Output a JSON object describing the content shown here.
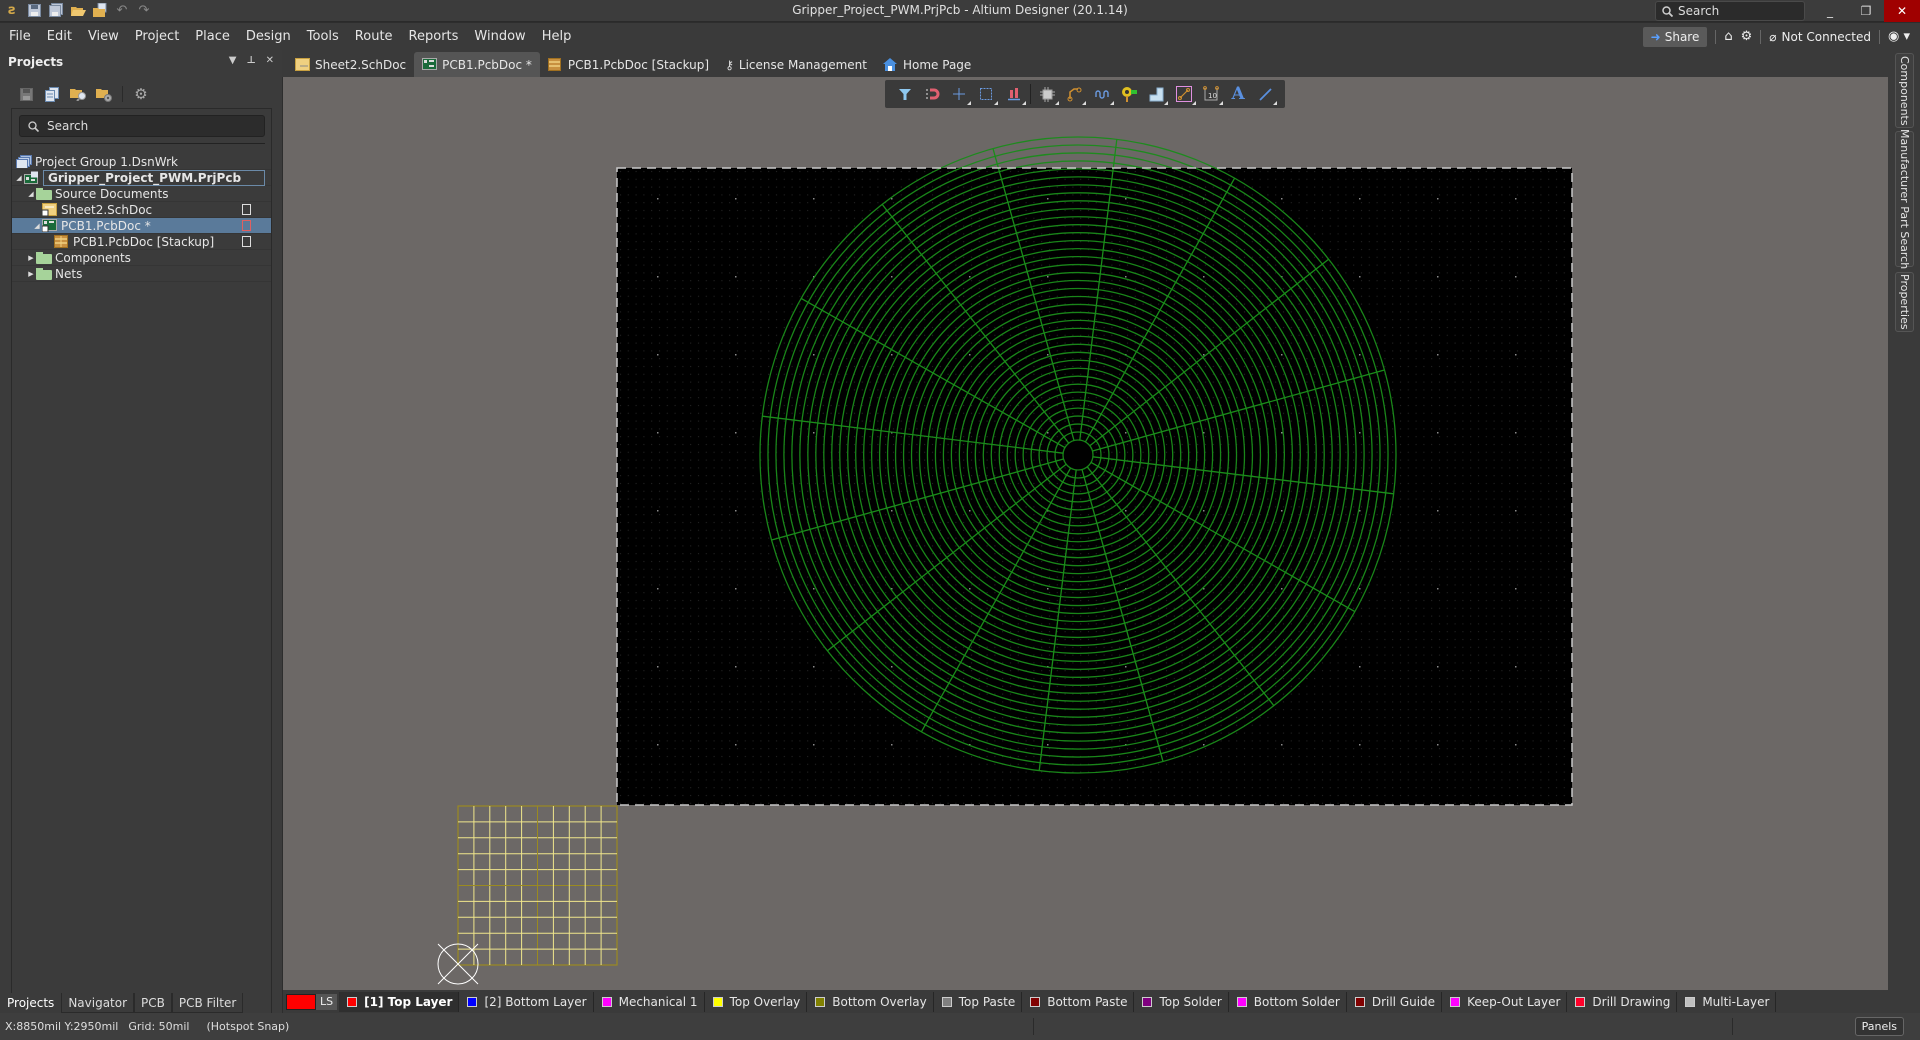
{
  "window": {
    "title": "Gripper_Project_PWM.PrjPcb - Altium Designer (20.1.14)",
    "search_placeholder": "Search",
    "minimize": "_",
    "restore": "❐",
    "close": "✕"
  },
  "menubar": {
    "items": [
      "File",
      "Edit",
      "View",
      "Project",
      "Place",
      "Design",
      "Tools",
      "Route",
      "Reports",
      "Window",
      "Help"
    ],
    "share_label": "Share",
    "connection_status": "Not Connected"
  },
  "projects_panel": {
    "title": "Projects",
    "search_placeholder": "Search",
    "tree": [
      {
        "label": "Project Group 1.DsnWrk",
        "level": 0,
        "icon": "workspace-icon"
      },
      {
        "label": "Gripper_Project_PWM.PrjPcb",
        "level": 1,
        "icon": "pcb-project-icon",
        "expanded": true,
        "bold": true
      },
      {
        "label": "Source Documents",
        "level": 2,
        "icon": "folder-icon",
        "expanded": true
      },
      {
        "label": "Sheet2.SchDoc",
        "level": 3,
        "icon": "schematic-doc-icon",
        "status": "saved"
      },
      {
        "label": "PCB1.PcbDoc *",
        "level": 3,
        "icon": "pcb-doc-icon",
        "expanded": true,
        "selected": true,
        "status": "modified"
      },
      {
        "label": "PCB1.PcbDoc [Stackup]",
        "level": 4,
        "icon": "stackup-icon",
        "status": "saved"
      },
      {
        "label": "Components",
        "level": 2,
        "icon": "folder-icon",
        "expanded": false
      },
      {
        "label": "Nets",
        "level": 2,
        "icon": "folder-icon",
        "expanded": false
      }
    ],
    "bottom_tabs": [
      "Projects",
      "Navigator",
      "PCB",
      "PCB Filter"
    ]
  },
  "document_tabs": [
    {
      "label": "Sheet2.SchDoc",
      "icon": "schematic-doc-icon",
      "active": false
    },
    {
      "label": "PCB1.PcbDoc *",
      "icon": "pcb-doc-icon",
      "active": true
    },
    {
      "label": "PCB1.PcbDoc [Stackup]",
      "icon": "stackup-icon",
      "active": false
    },
    {
      "label": "License Management",
      "icon": "key-icon",
      "active": false
    },
    {
      "label": "Home Page",
      "icon": "home-icon",
      "active": false
    }
  ],
  "pcb_toolbar": [
    "filter-icon",
    "interactive-routing-snap-icon",
    "crosshair-icon",
    "select-area-icon",
    "align-icon",
    "component-icon",
    "route-icon",
    "diff-pair-icon",
    "pad-via-icon",
    "polygon-pour-icon",
    "track-icon",
    "dimension-icon",
    "text-icon",
    "line-icon"
  ],
  "right_panels": [
    "Components",
    "Manufacturer Part Search",
    "Properties"
  ],
  "board": {
    "colors": {
      "board": "#000000",
      "canvas": "#6c6866",
      "trace": "#1a8c1a",
      "outline": "#c8c8c8",
      "mechanical_grid": "#f0e68c"
    },
    "spiral_rings": 38,
    "spokes": 16
  },
  "layer_tabs": {
    "ls_label": "LS",
    "ls_color": "#ff0000",
    "layers": [
      {
        "label": "[1] Top Layer",
        "color": "#ff0000",
        "active": true
      },
      {
        "label": "[2] Bottom Layer",
        "color": "#0000ff"
      },
      {
        "label": "Mechanical 1",
        "color": "#ff00ff"
      },
      {
        "label": "Top Overlay",
        "color": "#ffff00"
      },
      {
        "label": "Bottom Overlay",
        "color": "#808000"
      },
      {
        "label": "Top Paste",
        "color": "#808080"
      },
      {
        "label": "Bottom Paste",
        "color": "#800000"
      },
      {
        "label": "Top Solder",
        "color": "#800080"
      },
      {
        "label": "Bottom Solder",
        "color": "#ff00ff"
      },
      {
        "label": "Drill Guide",
        "color": "#800000"
      },
      {
        "label": "Keep-Out Layer",
        "color": "#ff00ff"
      },
      {
        "label": "Drill Drawing",
        "color": "#ff002a"
      },
      {
        "label": "Multi-Layer",
        "color": "#c0c0c0"
      }
    ]
  },
  "statusbar": {
    "coordinates": "X:8850mil Y:2950mil",
    "grid": "Grid: 50mil",
    "snap": "(Hotspot Snap)",
    "panels_button": "Panels"
  }
}
